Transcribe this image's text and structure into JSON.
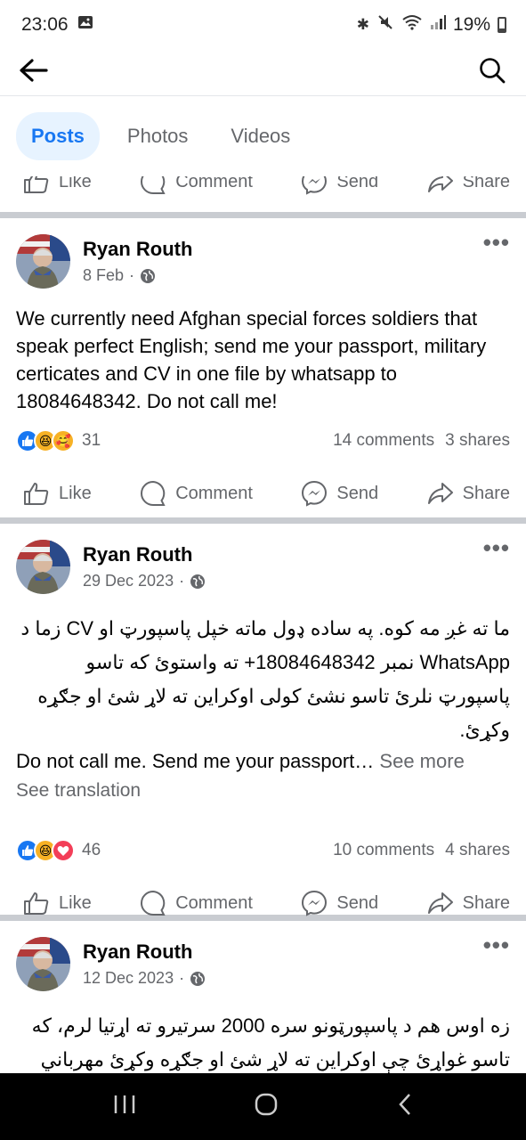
{
  "status": {
    "time": "23:06",
    "battery": "19%"
  },
  "tabs": [
    {
      "label": "Posts",
      "active": true
    },
    {
      "label": "Photos",
      "active": false
    },
    {
      "label": "Videos",
      "active": false
    }
  ],
  "actions": {
    "like": "Like",
    "comment": "Comment",
    "send": "Send",
    "share": "Share"
  },
  "posts": [
    {
      "author": "Ryan Routh",
      "date": "8 Feb",
      "text": "We currently need Afghan special forces soldiers that speak perfect English; send me your passport, military certicates and CV in one file by whatsapp to 18084648342. Do not call me!",
      "reaction_count": "31",
      "comments": "14 comments",
      "shares": "3 shares"
    },
    {
      "author": "Ryan Routh",
      "date": "29 Dec 2023",
      "text_rtl": "ما ته غږ مه کوه. په ساده ډول ماته خپل پاسپورټ او CV زما د WhatsApp نمبر 18084648342+ ته واستوئ که تاسو پاسپورټ نلرئ تاسو نشئ کولی اوکراین ته لاړ شئ او جګړه وکړئ.",
      "text_en": "Do not call me. Send me your passport…",
      "see_more": "See more",
      "see_translation": "See translation",
      "reaction_count": "46",
      "comments": "10 comments",
      "shares": "4 shares"
    },
    {
      "author": "Ryan Routh",
      "date": "12 Dec 2023",
      "text_rtl": "زه اوس هم د پاسپورټونو سره 2000 سرتیرو ته اړتیا لرم، که تاسو غواړئ چې اوکراین ته لاړ شئ او جګړه وکړئ مهرباني"
    }
  ],
  "colors": {
    "accent": "#1877f2",
    "muted": "#65676b",
    "divider": "#c9ccd1"
  }
}
